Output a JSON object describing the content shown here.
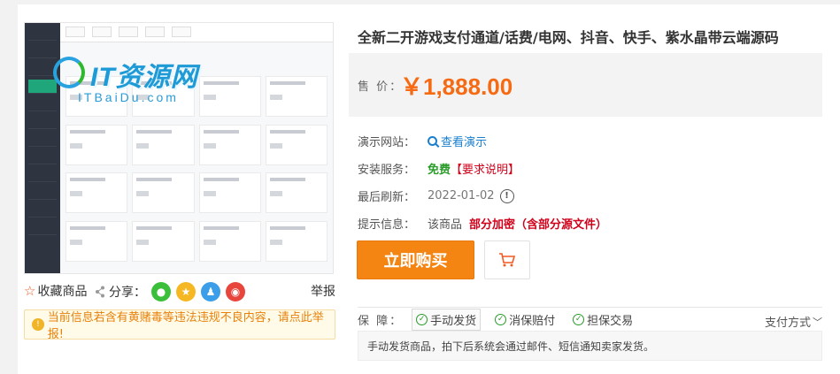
{
  "product": {
    "title": "全新二开游戏支付通道/话费/电网、抖音、快手、紫水晶带云端源码",
    "price_label": "售 价：",
    "price": "￥1,888.00"
  },
  "preview": {
    "watermark_main": "IT资源网",
    "watermark_sub": "ITBaiDu.com"
  },
  "actions": {
    "favorite_label": "收藏商品",
    "share_label": "分享：",
    "report_label": "举报",
    "share_icons": [
      "wechat-icon",
      "qzone-icon",
      "qq-icon",
      "weibo-icon"
    ]
  },
  "notice": "当前信息若含有黄赌毒等违法违规不良内容，请点此举报!",
  "details": {
    "demo_label": "演示网站：",
    "demo_link": "查看演示",
    "install_label": "安装服务：",
    "install_value": "免费",
    "install_note": "【要求说明】",
    "refresh_label": "最后刷新：",
    "refresh_date": "2022-01-02",
    "tip_label": "提示信息：",
    "tip_prefix": "该商品",
    "tip_value": "部分加密（含部分源文件）"
  },
  "buttons": {
    "buy": "立即购买"
  },
  "guarantee": {
    "label": "保 障：",
    "items": [
      "手动发货",
      "消保赔付",
      "担保交易"
    ],
    "pay_label": "支付方式",
    "desc": "手动发货商品，拍下后系统会通过邮件、短信通知卖家发货。"
  },
  "colors": {
    "accent": "#f48512",
    "price": "#f56a12",
    "link": "#1a7fcf",
    "alert": "#d0021b",
    "ok": "#2a9c2a"
  }
}
